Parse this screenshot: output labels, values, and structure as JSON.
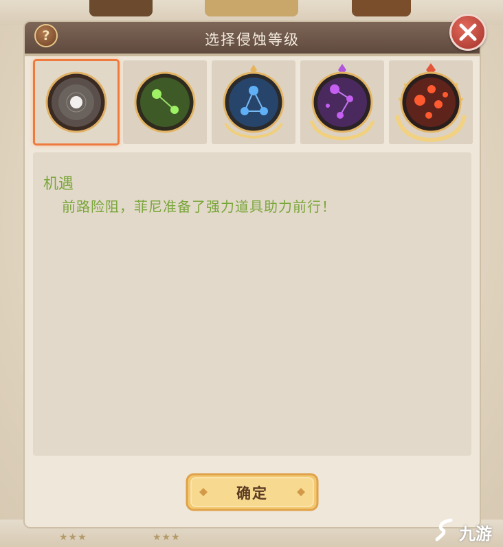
{
  "dialog": {
    "title": "选择侵蚀等级",
    "help_label": "?",
    "close_icon": "close-x-icon"
  },
  "levels": [
    {
      "name": "level-1",
      "color": "#d9d6d2",
      "icon": "gray-orb-icon",
      "selected": true
    },
    {
      "name": "level-2",
      "color": "#7ed04b",
      "icon": "green-constellation-icon",
      "selected": false
    },
    {
      "name": "level-3",
      "color": "#4c9de0",
      "icon": "blue-constellation-icon",
      "selected": false
    },
    {
      "name": "level-4",
      "color": "#b84fe0",
      "icon": "purple-constellation-icon",
      "selected": false
    },
    {
      "name": "level-5",
      "color": "#f0502a",
      "icon": "red-constellation-icon",
      "selected": false
    }
  ],
  "description": {
    "title": "机遇",
    "text": "前路险阻，菲尼准备了强力道具助力前行！"
  },
  "confirm": {
    "label": "确定"
  },
  "watermark": {
    "text": "九游"
  },
  "colors": {
    "accent_green": "#7aa63a",
    "selection_orange": "#ef7a3e",
    "titlebar": "#6e5648"
  }
}
